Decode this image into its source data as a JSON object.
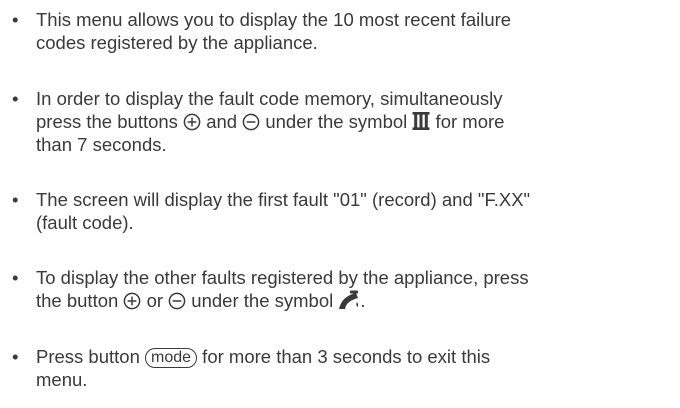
{
  "bullet": "•",
  "items": [
    {
      "lines": [
        "This menu allows you to display the 10 most recent failure",
        "codes registered by the appliance."
      ]
    },
    {
      "line1": "In order to display the fault code memory, simultaneously",
      "l2_a": "press the buttons ",
      "l2_b": " and ",
      "l2_c": " under the symbol ",
      "l2_d": " for more",
      "line3": "than 7 seconds."
    },
    {
      "lines": [
        "The screen will display the first fault \"01\" (record) and \"F.XX\"",
        "(fault code)."
      ]
    },
    {
      "line1": "To display the other faults registered by the appliance, press",
      "l2_a": "the button ",
      "l2_b": " or ",
      "l2_c": " under the symbol ",
      "l2_d": "."
    },
    {
      "l1_a": "Press button ",
      "mode_label": "mode",
      "l1_b": " for more than 3 seconds to exit this",
      "line2": "menu."
    }
  ],
  "icons": {
    "plus": "plus-circle-icon",
    "minus": "minus-circle-icon",
    "heating": "radiator-icon",
    "hot_water": "tap-icon"
  },
  "colors": {
    "text": "#3a3a3a",
    "background": "#ffffff"
  }
}
